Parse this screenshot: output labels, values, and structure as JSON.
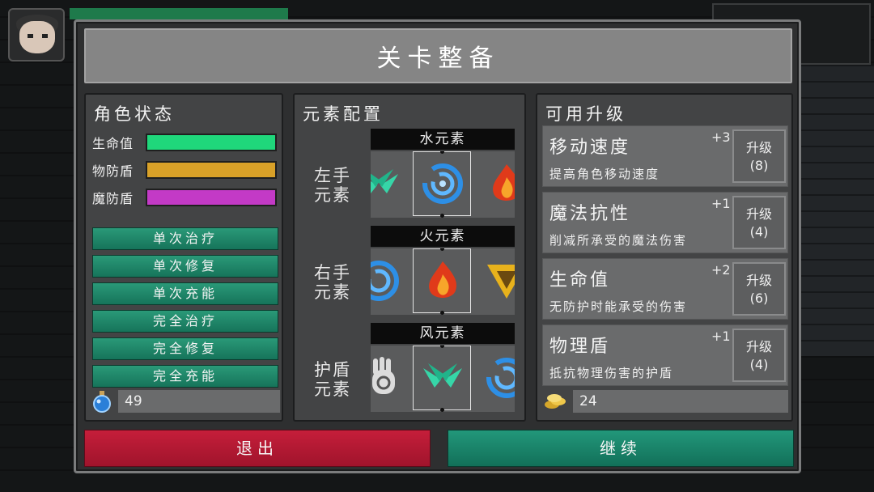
{
  "dialog": {
    "title": "关卡整备"
  },
  "status": {
    "title": "角色状态",
    "stats": [
      {
        "label": "生命值",
        "color": "#1fd77b"
      },
      {
        "label": "物防盾",
        "color": "#d9a128"
      },
      {
        "label": "魔防盾",
        "color": "#c33ac6"
      }
    ],
    "actions": [
      "单次治疗",
      "单次修复",
      "单次充能",
      "完全治疗",
      "完全修复",
      "完全充能"
    ],
    "potion_count": "49"
  },
  "elements": {
    "title": "元素配置",
    "slots": [
      {
        "label": "左手元素",
        "selected": "水元素",
        "icons": [
          "wind-element-icon",
          "water-element-icon",
          "fire-element-icon"
        ]
      },
      {
        "label": "右手元素",
        "selected": "火元素",
        "icons": [
          "water-element-icon",
          "fire-element-icon",
          "earth-element-icon"
        ]
      },
      {
        "label": "护盾元素",
        "selected": "风元素",
        "icons": [
          "palm-element-icon",
          "wind-element-icon",
          "water-element-icon"
        ]
      }
    ]
  },
  "upgrades": {
    "title": "可用升级",
    "items": [
      {
        "name": "移动速度",
        "desc": "提高角色移动速度",
        "plus": "+3",
        "btn": "升级",
        "cost": "(8)"
      },
      {
        "name": "魔法抗性",
        "desc": "削减所承受的魔法伤害",
        "plus": "+1",
        "btn": "升级",
        "cost": "(4)"
      },
      {
        "name": "生命值",
        "desc": "无防护时能承受的伤害",
        "plus": "+2",
        "btn": "升级",
        "cost": "(6)"
      },
      {
        "name": "物理盾",
        "desc": "抵抗物理伤害的护盾",
        "plus": "+1",
        "btn": "升级",
        "cost": "(4)"
      }
    ],
    "coin_count": "24"
  },
  "footer": {
    "exit": "退出",
    "continue": "继续"
  }
}
